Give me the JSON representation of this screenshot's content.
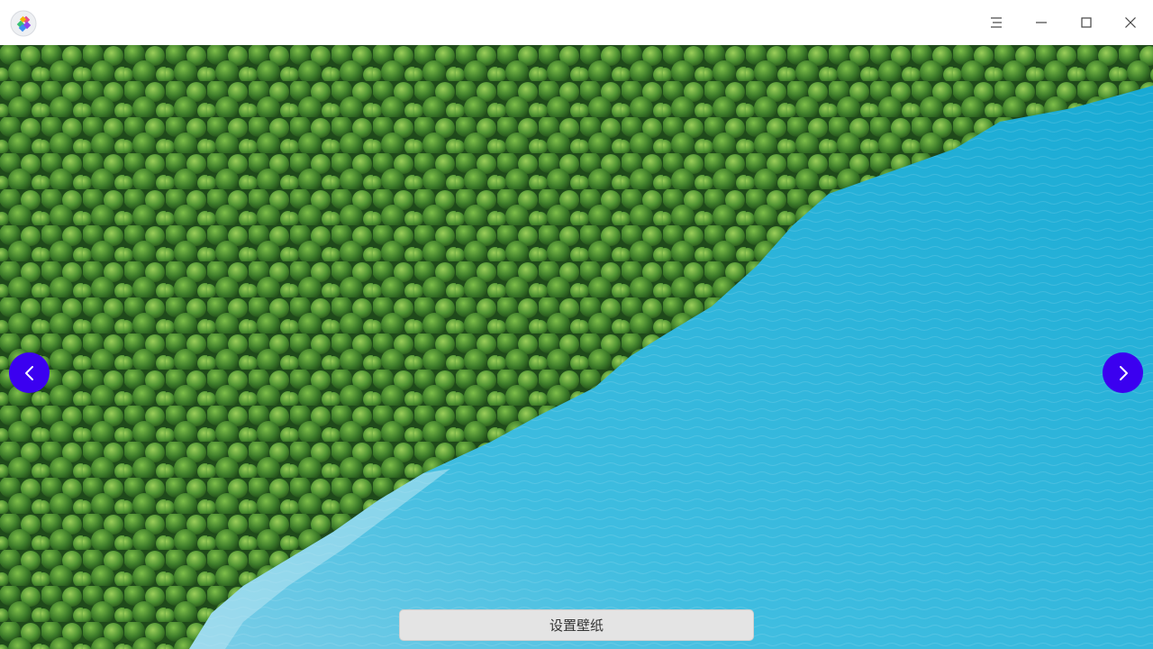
{
  "titlebar": {
    "icons": {
      "logo": "app-logo-icon",
      "menu": "menu-icon",
      "minimize": "minimize-icon",
      "maximize": "maximize-icon",
      "close": "close-icon"
    }
  },
  "viewer": {
    "prev_icon": "chevron-left-icon",
    "next_icon": "chevron-right-icon",
    "set_wallpaper_label": "设置壁纸"
  },
  "colors": {
    "accent": "#3b00f0",
    "water": "#2cb4d8",
    "forest": "#2f6b24",
    "button_bg": "#e4e4e4",
    "titlebar_bg": "#ffffff"
  }
}
